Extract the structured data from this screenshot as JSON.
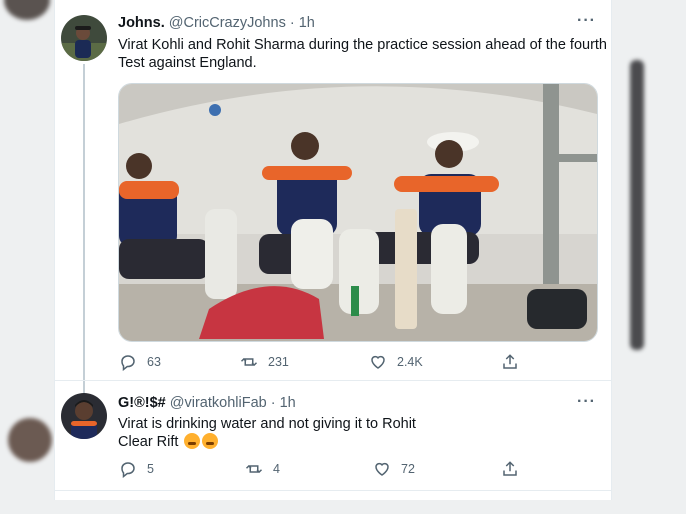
{
  "tweet1": {
    "name": "Johns.",
    "handle": "@CricCrazyJohns",
    "separator": "·",
    "time": "1h",
    "text_line1": "Virat Kohli and Rohit Sharma during the practice session ahead of the fourth",
    "text_line2": "Test against England.",
    "replies": "63",
    "retweets": "231",
    "likes": "2.4K"
  },
  "tweet2": {
    "name": "G!®!$#",
    "handle": "@viratkohliFab",
    "separator": "·",
    "time": "1h",
    "text_line1": "Virat is drinking water and not giving it to Rohit",
    "text_line2": "Clear Rift",
    "replies": "5",
    "retweets": "4",
    "likes": "72"
  },
  "icons": {
    "more": "more-horizontal-icon",
    "reply": "reply-icon",
    "retweet": "retweet-icon",
    "like": "heart-icon",
    "share": "share-icon",
    "emoji": "angry-face-icon"
  },
  "colors": {
    "text": "#0f1419",
    "muted": "#536471",
    "border": "#e6ecf0",
    "jersey": "#1e2a5a",
    "jersey_accent": "#e8652a"
  }
}
